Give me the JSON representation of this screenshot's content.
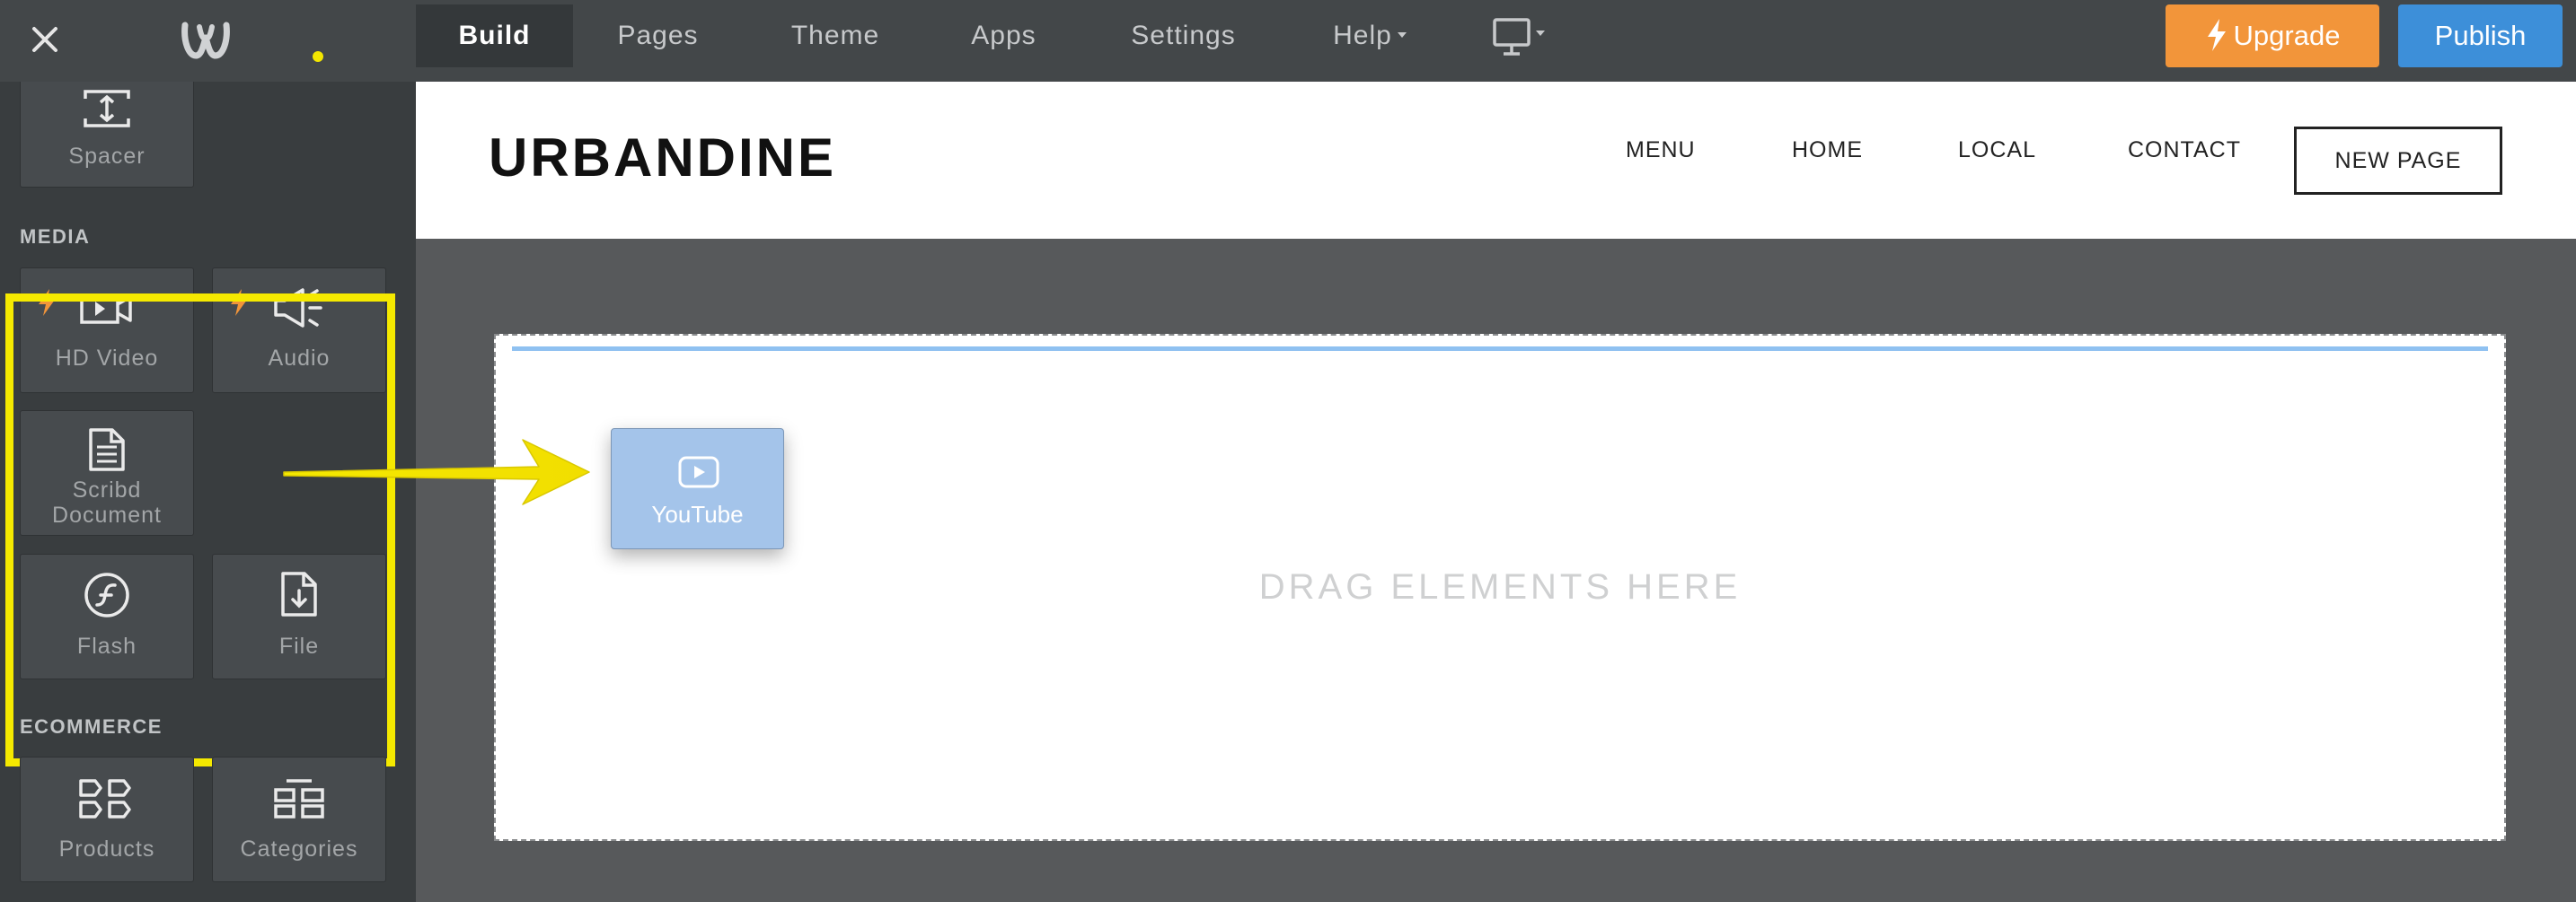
{
  "topbar": {
    "tabs": [
      {
        "label": "Build"
      },
      {
        "label": "Pages"
      },
      {
        "label": "Theme"
      },
      {
        "label": "Apps"
      },
      {
        "label": "Settings"
      },
      {
        "label": "Help"
      }
    ],
    "upgrade_label": "Upgrade",
    "publish_label": "Publish",
    "colors": {
      "upgrade": "#f2953a",
      "publish": "#3d8fd9",
      "bar": "#434749"
    }
  },
  "sidebar": {
    "spacer_label": "Spacer",
    "media_title": "MEDIA",
    "media_items": [
      {
        "label": "HD Video",
        "icon": "video-icon"
      },
      {
        "label": "Audio",
        "icon": "speaker-icon"
      },
      {
        "label": "Scribd Document",
        "icon": "document-icon"
      },
      {
        "label": "Flash",
        "icon": "flash-icon"
      },
      {
        "label": "File",
        "icon": "file-download-icon"
      }
    ],
    "ecommerce_title": "ECOMMERCE",
    "ecommerce_items": [
      {
        "label": "Products",
        "icon": "products-icon"
      },
      {
        "label": "Categories",
        "icon": "categories-icon"
      }
    ]
  },
  "site": {
    "logo": "URBANDINE",
    "nav": [
      "MENU",
      "HOME",
      "LOCAL",
      "CONTACT",
      "NEW PAGE"
    ]
  },
  "dropzone": {
    "text": "DRAG ELEMENTS HERE"
  },
  "dragged": {
    "label": "YouTube",
    "icon": "youtube-play-icon"
  },
  "annotation": {
    "highlight_color": "#f5e900"
  }
}
